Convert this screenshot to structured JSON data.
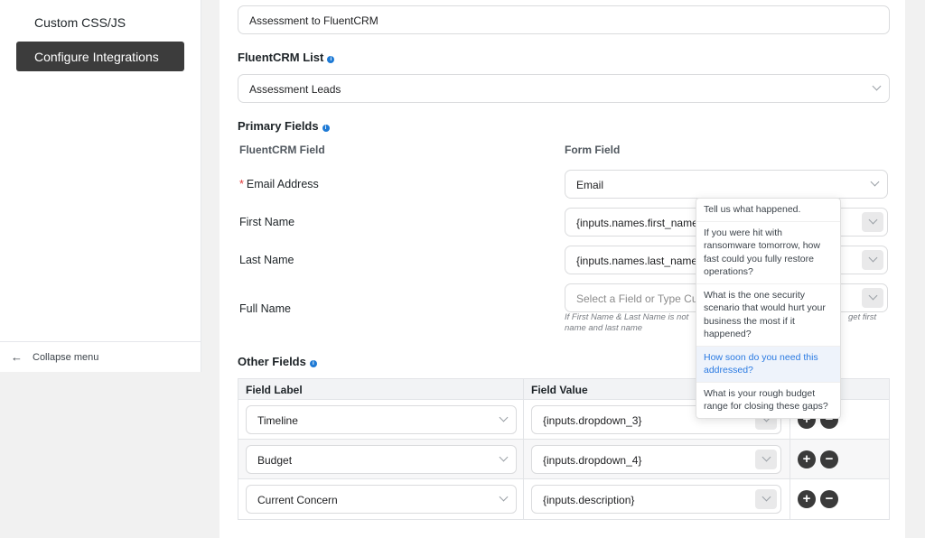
{
  "sidebar": {
    "item_custom_css": "Custom CSS/JS",
    "item_configure": "Configure Integrations",
    "collapse_label": "Collapse menu"
  },
  "integration": {
    "name_value": "Assessment to FluentCRM",
    "list_label": "FluentCRM List",
    "list_value": "Assessment Leads"
  },
  "primary": {
    "title": "Primary Fields",
    "col_crm": "FluentCRM Field",
    "col_form": "Form Field",
    "rows": [
      {
        "label": "Email Address",
        "required": true,
        "value": "Email"
      },
      {
        "label": "First Name",
        "value": "{inputs.names.first_name}"
      },
      {
        "label": "Last Name",
        "value": "{inputs.names.last_name}"
      },
      {
        "label": "Full Name",
        "placeholder": "Select a Field or Type Custom Value"
      }
    ],
    "fullname_help_left": "If First Name & Last Name is not",
    "fullname_help_right": "get first",
    "fullname_help_line2": "name and last name"
  },
  "other": {
    "title": "Other Fields",
    "col_label": "Field Label",
    "col_value": "Field Value",
    "rows": [
      {
        "label": "Timeline",
        "value": "{inputs.dropdown_3}"
      },
      {
        "label": "Budget",
        "value": "{inputs.dropdown_4}"
      },
      {
        "label": "Current Concern",
        "value": "{inputs.description}"
      }
    ]
  },
  "popup": {
    "options": [
      "Tell us what happened.",
      "If you were hit with ransomware tomorrow, how fast could you fully restore operations?",
      "What is the one security scenario that would hurt your business the most if it happened?",
      "How soon do you need this addressed?",
      "What is your rough budget range for closing these gaps?"
    ],
    "highlighted_index": 3
  },
  "icons": {
    "info": "info-icon",
    "collapse": "arrow-left-icon",
    "add": "plus-circle-icon",
    "remove": "minus-circle-icon",
    "dropdown": "chevron-down-icon"
  },
  "colors": {
    "accent": "#1e7ad5",
    "sidebar_active": "#3c3c3c",
    "required": "#e03535",
    "highlight_text": "#2a7ae2"
  }
}
